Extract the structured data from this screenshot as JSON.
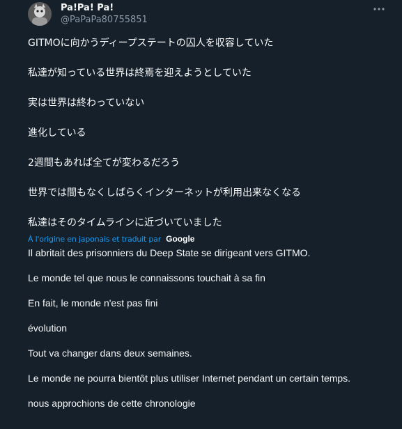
{
  "header": {
    "display_name": "Pa!Pa! Pa!",
    "handle": "@PaPaPa80755851",
    "more_icon": "more-horizontal-icon"
  },
  "original_text": [
    "GITMOに向かうディープステートの囚人を収容していた",
    "私達が知っている世界は終焉を迎えようとしていた",
    "実は世界は終わっていない",
    "進化している",
    "2週間もあれば全てが変わるだろう",
    "世界では間もなくしばらくインターネットが利用出来なくなる",
    "私達はそのタイムラインに近づいていました"
  ],
  "translation": {
    "label": "À l'origine en japonais et traduit par",
    "provider": "Google"
  },
  "translated_text": [
    "Il abritait des prisonniers du Deep State se dirigeant vers GITMO.",
    "Le monde tel que nous le connaissons touchait à sa fin",
    "En fait, le monde n'est pas fini",
    "évolution",
    "Tout va changer dans deux semaines.",
    "Le monde ne pourra bientôt plus utiliser Internet pendant un certain temps.",
    "nous approchions de cette chronologie"
  ],
  "colors": {
    "background": "#15202b",
    "text": "#f7f9f9",
    "secondary": "#8b98a5",
    "link": "#1d9bf0"
  }
}
